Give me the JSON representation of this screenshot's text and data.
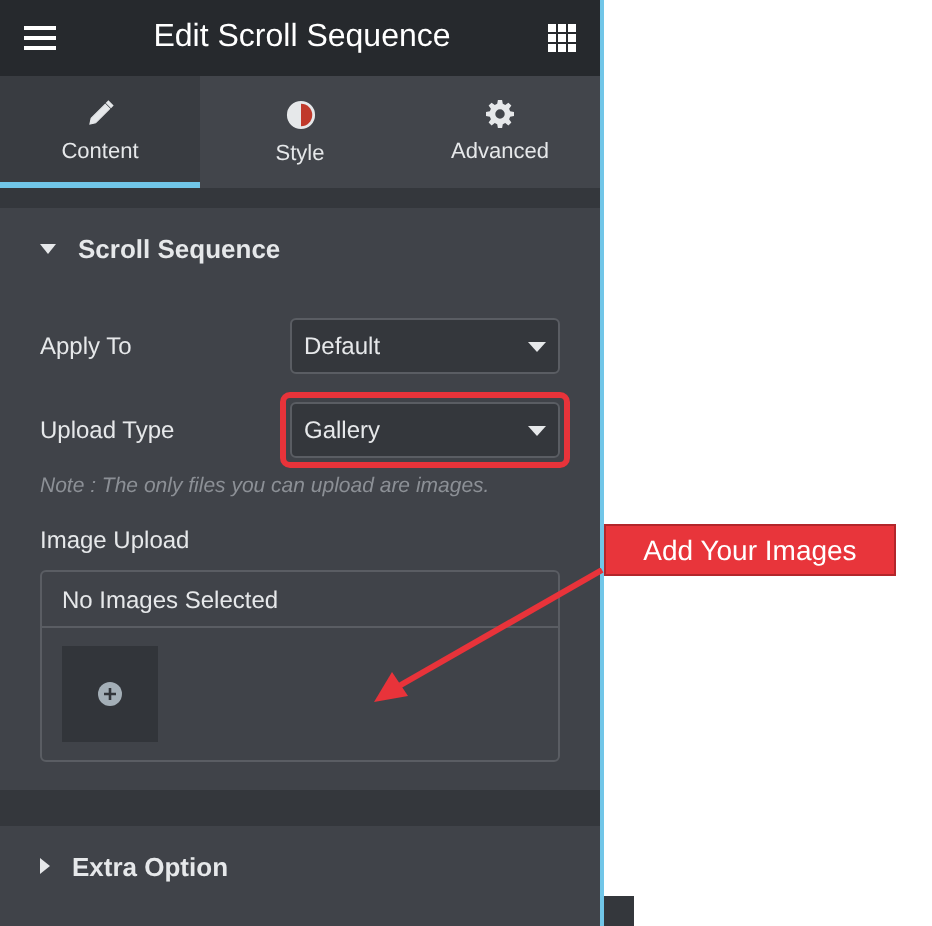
{
  "header": {
    "title": "Edit Scroll Sequence"
  },
  "tabs": [
    {
      "label": "Content",
      "selected": true
    },
    {
      "label": "Style",
      "selected": false
    },
    {
      "label": "Advanced",
      "selected": false
    }
  ],
  "sections": [
    {
      "title": "Scroll Sequence",
      "expanded": true,
      "controls": [
        {
          "kind": "select",
          "label": "Apply To",
          "value": "Default",
          "highlighted": false
        },
        {
          "kind": "select",
          "label": "Upload Type",
          "value": "Gallery",
          "highlighted": true
        },
        {
          "kind": "note",
          "text": "Note : The only files you can upload are images."
        },
        {
          "kind": "gallery",
          "label": "Image Upload",
          "status": "No Images Selected"
        }
      ]
    },
    {
      "title": "Extra Option",
      "expanded": false
    }
  ],
  "annotation": {
    "text": "Add Your Images"
  }
}
